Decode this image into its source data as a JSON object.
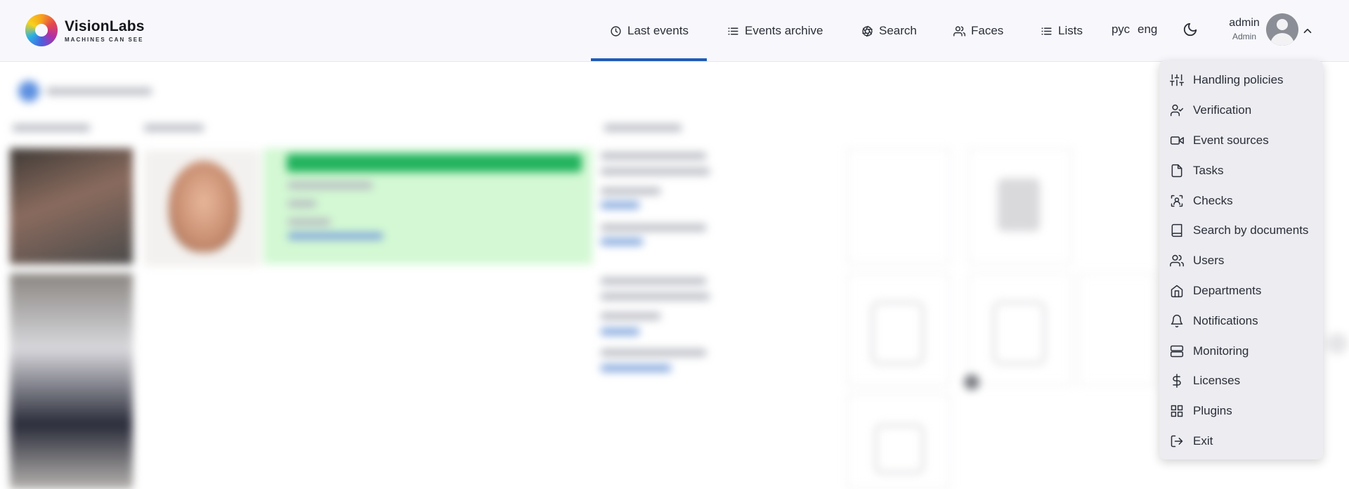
{
  "brand": {
    "name": "VisionLabs",
    "tagline": "MACHINES CAN SEE",
    "logo_icon": "visionlabs-logo"
  },
  "nav": {
    "items": [
      {
        "label": "Last events",
        "icon": "clock-icon",
        "active": true
      },
      {
        "label": "Events archive",
        "icon": "list-icon"
      },
      {
        "label": "Search",
        "icon": "aperture-icon"
      },
      {
        "label": "Faces",
        "icon": "users-icon"
      },
      {
        "label": "Lists",
        "icon": "list-icon"
      }
    ],
    "active_color": "#1f5bb8"
  },
  "lang": {
    "ru": "рус",
    "en": "eng"
  },
  "user": {
    "name": "admin",
    "role": "Admin"
  },
  "menu": {
    "items": [
      {
        "label": "Handling policies",
        "icon": "sliders-icon"
      },
      {
        "label": "Verification",
        "icon": "user-check-icon"
      },
      {
        "label": "Event sources",
        "icon": "video-icon"
      },
      {
        "label": "Tasks",
        "icon": "file-icon"
      },
      {
        "label": "Checks",
        "icon": "face-scan-icon"
      },
      {
        "label": "Search by documents",
        "icon": "book-icon"
      },
      {
        "label": "Users",
        "icon": "users-icon"
      },
      {
        "label": "Departments",
        "icon": "home-icon"
      },
      {
        "label": "Notifications",
        "icon": "bell-icon"
      },
      {
        "label": "Monitoring",
        "icon": "server-icon"
      },
      {
        "label": "Licenses",
        "icon": "dollar-icon"
      },
      {
        "label": "Plugins",
        "icon": "grid-icon"
      },
      {
        "label": "Exit",
        "icon": "log-out-icon"
      }
    ]
  },
  "colors": {
    "match_bar": "#22b35e",
    "match_bg": "#d3f8d3"
  }
}
